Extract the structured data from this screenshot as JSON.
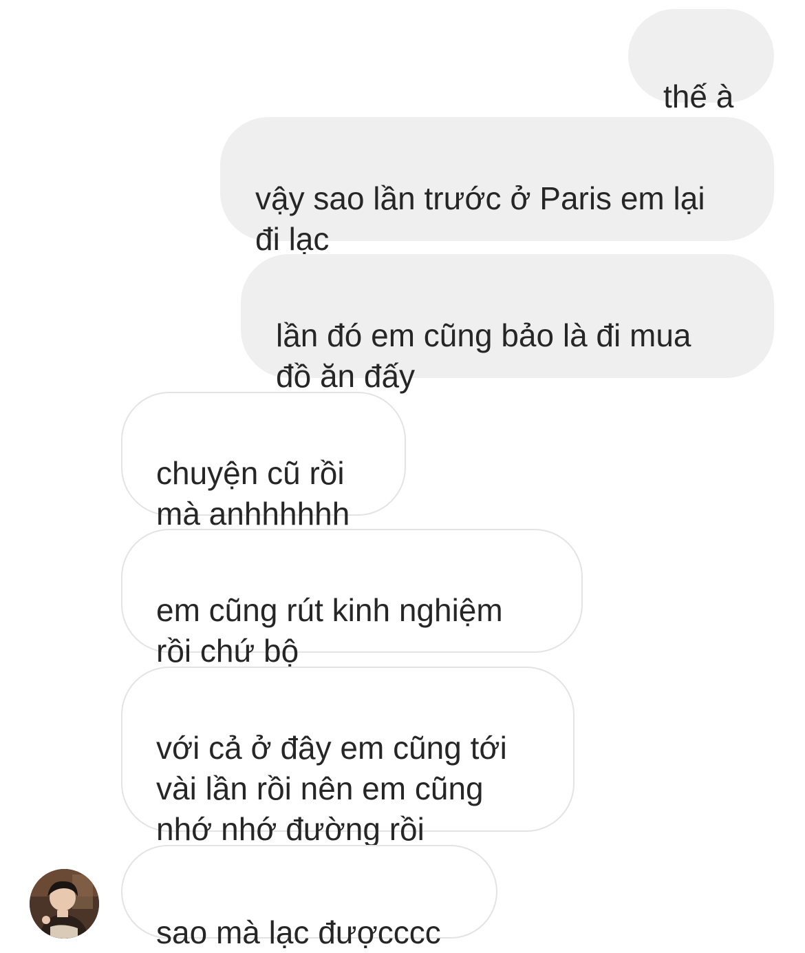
{
  "messages": {
    "sent": [
      {
        "text": "thế à"
      },
      {
        "text": "vậy sao lần trước ở Paris em lại\nđi lạc"
      },
      {
        "text": "lần đó em cũng bảo là đi mua\nđồ ăn đấy"
      }
    ],
    "received": [
      {
        "text": "chuyện cũ rồi\nmà anhhhhhh"
      },
      {
        "text": "em cũng rút kinh nghiệm\nrồi chứ bộ"
      },
      {
        "text": "với cả ở đây em cũng tới\nvài lần rồi nên em cũng\nnhớ nhớ đường rồi"
      },
      {
        "text": "sao mà lạc đượcccc"
      }
    ]
  },
  "colors": {
    "sent_bubble": "#efefef",
    "received_border": "#e3e3e3",
    "text": "#262626"
  },
  "avatar": {
    "icon": "user-avatar-photo"
  }
}
